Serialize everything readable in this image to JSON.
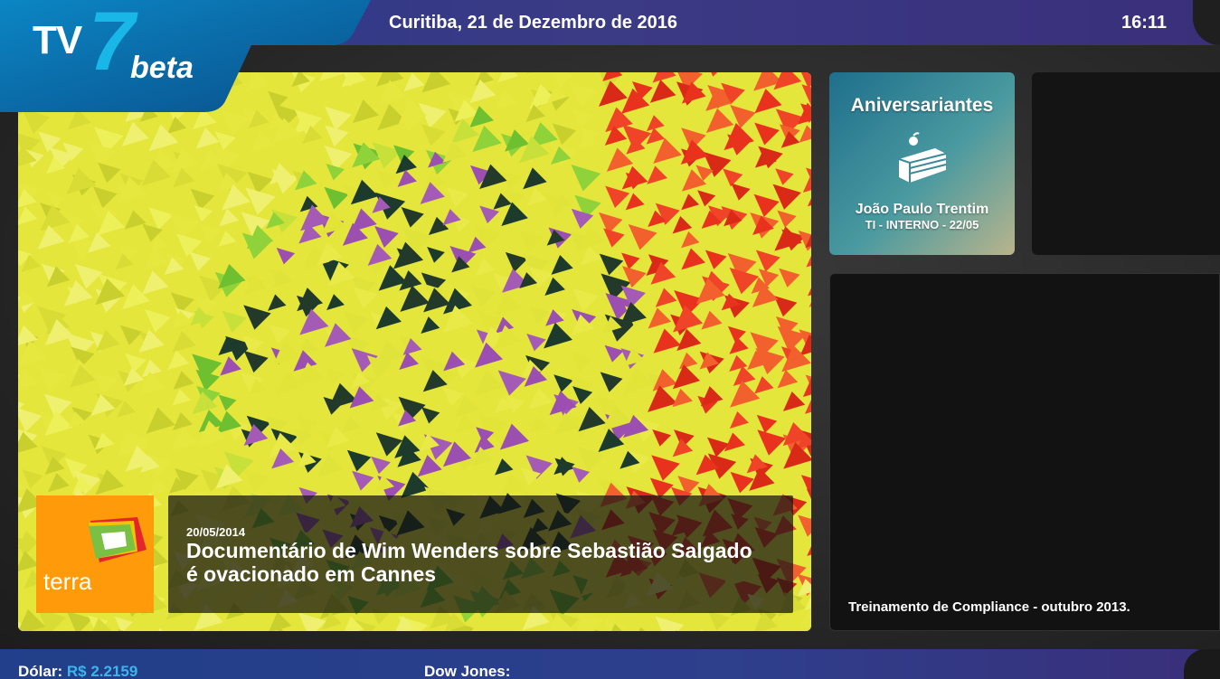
{
  "header": {
    "logo_tv": "TV",
    "logo_seven": "7",
    "logo_beta": "beta",
    "date": "Curitiba, 21 de Dezembro de 2016",
    "time": "16:11"
  },
  "news": {
    "source_logo_text": "terra",
    "date": "20/05/2014",
    "headline": "Documentário de Wim Wenders sobre Sebastião Salgado é ovacionado em Cannes"
  },
  "birthday": {
    "title": "Aniversariantes",
    "icon": "cake-icon",
    "name": "João Paulo Trentim",
    "detail": "TI - INTERNO - 22/05"
  },
  "video": {
    "caption": "Treinamento de Compliance - outubro 2013."
  },
  "ticker": {
    "dolar_label": "Dólar:",
    "dolar_value": "R$ 2.2159",
    "dow_label": "Dow Jones:"
  },
  "colors": {
    "accent": "#19b7e8",
    "terra_orange": "#ff9a0a",
    "bar_blue": "#2e3f8c"
  }
}
